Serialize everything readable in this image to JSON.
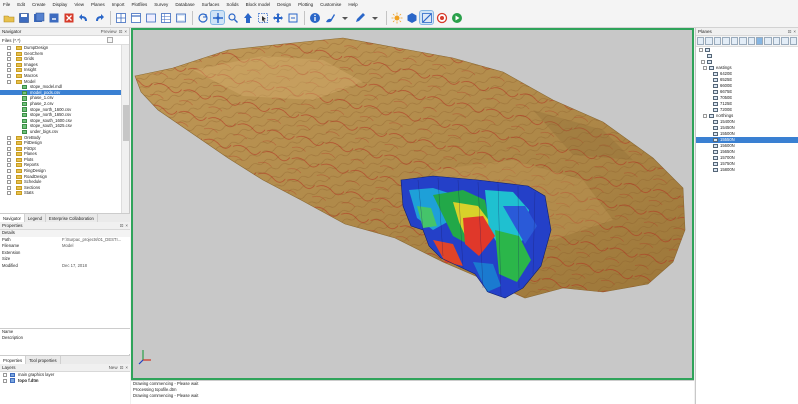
{
  "menu": [
    "File",
    "Edit",
    "Create",
    "Display",
    "View",
    "Planes",
    "Import",
    "Plotfiles",
    "Survey",
    "Database",
    "Surfaces",
    "Solids",
    "Block model",
    "Design",
    "Plotting",
    "Customise",
    "Help"
  ],
  "toolbar": {
    "icons": [
      "folder-open-icon",
      "save-icon",
      "save-all-icon",
      "close-file-icon",
      "delete-icon",
      "undo-icon",
      "redo-icon",
      "grid-icon",
      "layout-icon",
      "window-icon",
      "table-icon",
      "window2-icon",
      "rotate-icon",
      "pan-icon",
      "zoom-icon",
      "arrow-up-icon",
      "select-icon",
      "move-icon",
      "fit-icon",
      "info-icon",
      "brush-icon",
      "dropdown-icon",
      "pencil-icon",
      "dropdown2-icon",
      "light-icon",
      "shade-icon",
      "section-icon",
      "record-icon",
      "play-icon"
    ]
  },
  "navigator": {
    "title": "Navigator",
    "preview_label": "Preview",
    "filter": "Files (*.*)",
    "items": [
      {
        "label": "DumpDesign",
        "type": "folder",
        "level": 1
      },
      {
        "label": "GeoChem",
        "type": "folder",
        "level": 1
      },
      {
        "label": "Grids",
        "type": "folder",
        "level": 1
      },
      {
        "label": "Images",
        "type": "folder",
        "level": 1
      },
      {
        "label": "Insight",
        "type": "folder",
        "level": 1
      },
      {
        "label": "Macros",
        "type": "folder",
        "level": 1
      },
      {
        "label": "Model",
        "type": "folder",
        "level": 1
      },
      {
        "label": "stope_model.mdl",
        "type": "file",
        "level": 2
      },
      {
        "label": "model_pods.csv",
        "type": "file",
        "level": 2,
        "selected": true
      },
      {
        "label": "phase_1.csv",
        "type": "file",
        "level": 2
      },
      {
        "label": "phase_2.csv",
        "type": "file",
        "level": 2
      },
      {
        "label": "stope_north_1600.csv",
        "type": "file",
        "level": 2
      },
      {
        "label": "stope_north_1650.csv",
        "type": "file",
        "level": 2
      },
      {
        "label": "stope_south_1600.csv",
        "type": "file",
        "level": 2
      },
      {
        "label": "stope_south_1625.csv",
        "type": "file",
        "level": 2
      },
      {
        "label": "under_bigs.csv",
        "type": "file",
        "level": 2
      },
      {
        "label": "OreBody",
        "type": "folder",
        "level": 1
      },
      {
        "label": "PitDesign",
        "type": "folder",
        "level": 1
      },
      {
        "label": "PitOpt",
        "type": "folder",
        "level": 1
      },
      {
        "label": "Planes",
        "type": "folder",
        "level": 1
      },
      {
        "label": "Plots",
        "type": "folder",
        "level": 1
      },
      {
        "label": "Reports",
        "type": "folder",
        "level": 1
      },
      {
        "label": "RingDesign",
        "type": "folder",
        "level": 1
      },
      {
        "label": "RoadDesign",
        "type": "folder",
        "level": 1
      },
      {
        "label": "Schedule",
        "type": "folder",
        "level": 1
      },
      {
        "label": "Sections",
        "type": "folder",
        "level": 1
      },
      {
        "label": "Stats",
        "type": "folder",
        "level": 1
      }
    ]
  },
  "bottom_tabs": [
    "Navigator",
    "Legend",
    "Enterprise Collaboration"
  ],
  "properties": {
    "title": "Properties",
    "group": "Details",
    "rows": [
      {
        "k": "Path",
        "v": "F:\\Surpac_projects\\01_DESTI..."
      },
      {
        "k": "Filename",
        "v": "Model"
      },
      {
        "k": "Extension",
        "v": ""
      },
      {
        "k": "Size",
        "v": ""
      },
      {
        "k": "Modified",
        "v": "Dec 17, 2018"
      }
    ],
    "desc_title": "Name",
    "desc_text": "Description"
  },
  "props_tabs": [
    "Properties",
    "Tool properties"
  ],
  "layers": {
    "title": "Layers",
    "new_label": "New",
    "items": [
      "main graphics layer",
      "topo f.dtm"
    ]
  },
  "output": {
    "lines": [
      "Drawing commencing - Please wait",
      "Processing topofile.dtm",
      "Drawing commencing - Please wait"
    ]
  },
  "planes": {
    "title": "Planes",
    "groups": [
      {
        "label": "eastings",
        "items": [
          "6420E",
          "6525E",
          "6600E",
          "6675E",
          "7050E",
          "7125E",
          "7200E"
        ]
      },
      {
        "label": "northings",
        "items": [
          "15400N",
          "15450N",
          "15500N",
          "15550N",
          "15600N",
          "15650N",
          "15700N",
          "15750N",
          "15800N"
        ]
      }
    ],
    "selected": "15550N"
  },
  "colors": {
    "accent": "#2fa35a",
    "selection": "#3a80d2",
    "viewport_bg": "#c8c8c8",
    "terrain": "#b08a4a"
  }
}
